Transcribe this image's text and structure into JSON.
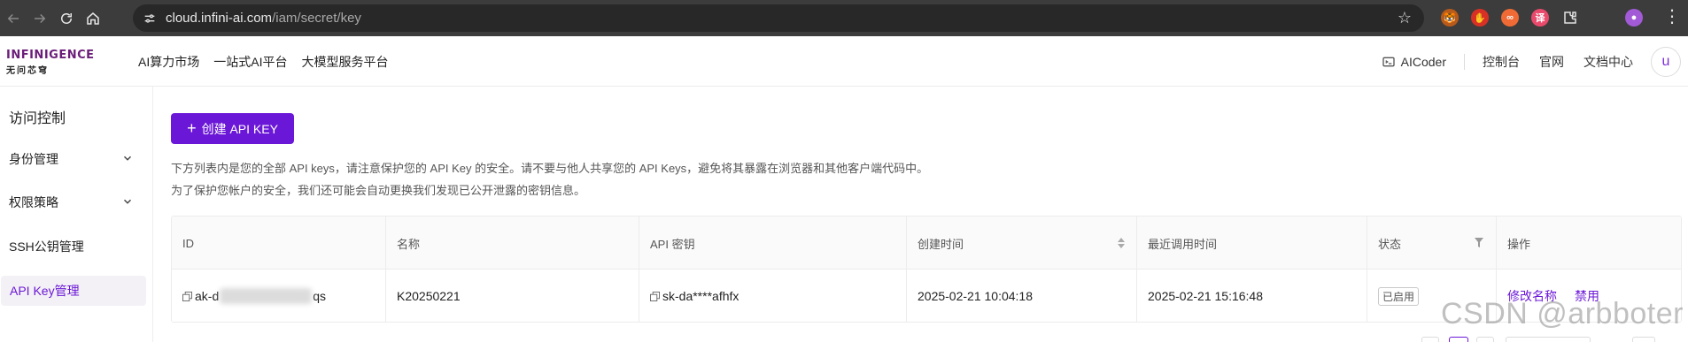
{
  "browser": {
    "url_host": "cloud.infini-ai.com",
    "url_path": "/iam/secret/key",
    "extensions": [
      {
        "icon": "tiger-extension-icon",
        "color": "#e07a1f",
        "glyph": "🐯"
      },
      {
        "icon": "shield-extension-icon",
        "color": "#d93025",
        "glyph": "✋"
      },
      {
        "icon": "infinity-extension-icon",
        "color": "#f06a35",
        "glyph": "∞"
      },
      {
        "icon": "translate-extension-icon",
        "color": "#e94a6b",
        "glyph": "译"
      }
    ]
  },
  "header": {
    "logo_top": "INFINIGENCE",
    "logo_bottom": "无问芯穹",
    "nav": [
      "AI算力市场",
      "一站式AI平台",
      "大模型服务平台"
    ],
    "aicoder": "AICoder",
    "links": [
      "控制台",
      "官网",
      "文档中心"
    ],
    "avatar_letter": "u"
  },
  "sidebar": {
    "title": "访问控制",
    "items": [
      {
        "label": "身份管理",
        "expandable": true
      },
      {
        "label": "权限策略",
        "expandable": true
      },
      {
        "label": "SSH公钥管理",
        "expandable": false
      },
      {
        "label": "API Key管理",
        "expandable": false,
        "active": true
      }
    ]
  },
  "main": {
    "create_button": "创建 API KEY",
    "desc_line1": "下方列表内是您的全部 API keys，请注意保护您的 API Key 的安全。请不要与他人共享您的 API Keys，避免将其暴露在浏览器和其他客户端代码中。",
    "desc_line2": "为了保护您帐户的安全，我们还可能会自动更换我们发现已公开泄露的密钥信息。",
    "table": {
      "headers": [
        "ID",
        "名称",
        "API 密钥",
        "创建时间",
        "最近调用时间",
        "状态",
        "操作"
      ],
      "rows": [
        {
          "id_prefix": "ak-d",
          "id_suffix": "qs",
          "name": "K20250221",
          "secret": "sk-da****afhfx",
          "created": "2025-02-21 10:04:18",
          "last_called": "2025-02-21 15:16:48",
          "status": "已启用",
          "actions": [
            "修改名称",
            "禁用"
          ]
        }
      ]
    }
  },
  "watermark": "CSDN @arbboter",
  "colors": {
    "accent": "#6b17d7",
    "browser_bar": "#3c3c3c"
  }
}
